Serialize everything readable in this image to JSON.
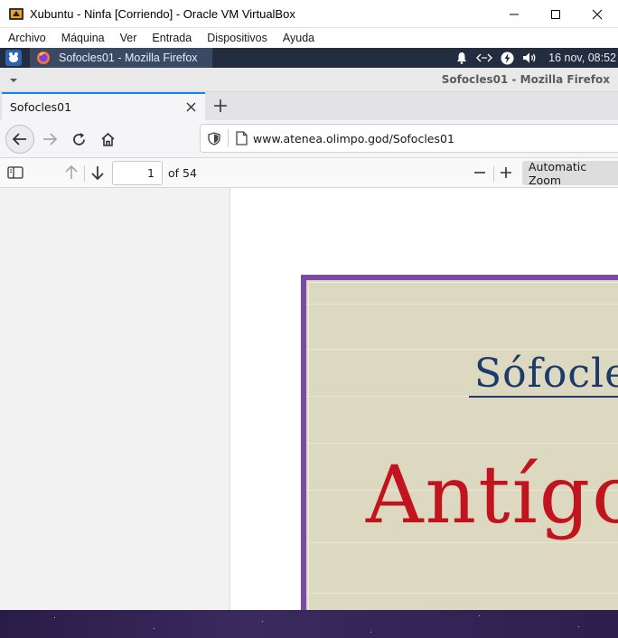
{
  "vbox": {
    "title": "Xubuntu - Ninfa [Corriendo] - Oracle VM VirtualBox",
    "menu": [
      "Archivo",
      "Máquina",
      "Ver",
      "Entrada",
      "Dispositivos",
      "Ayuda"
    ]
  },
  "panel": {
    "task_label": "Sofocles01 - Mozilla Firefox",
    "clock": "16 nov, 08:52"
  },
  "firefox": {
    "window_title": "Sofocles01 - Mozilla Firefox",
    "tab_title": "Sofocles01",
    "url": "www.atenea.olimpo.god/Sofocles01"
  },
  "pdf": {
    "page_number": "1",
    "page_count_label": "of 54",
    "zoom_label": "Automatic Zoom"
  },
  "document": {
    "author": "Sófocles",
    "work": "Antígona"
  },
  "colors": {
    "accent": "#0a84ff",
    "panel_bg": "#242d3f",
    "cover_bg": "#ddd9c1",
    "cover_border": "#7a4aa6",
    "title_red": "#c2141e",
    "author_blue": "#1c3b6a"
  }
}
